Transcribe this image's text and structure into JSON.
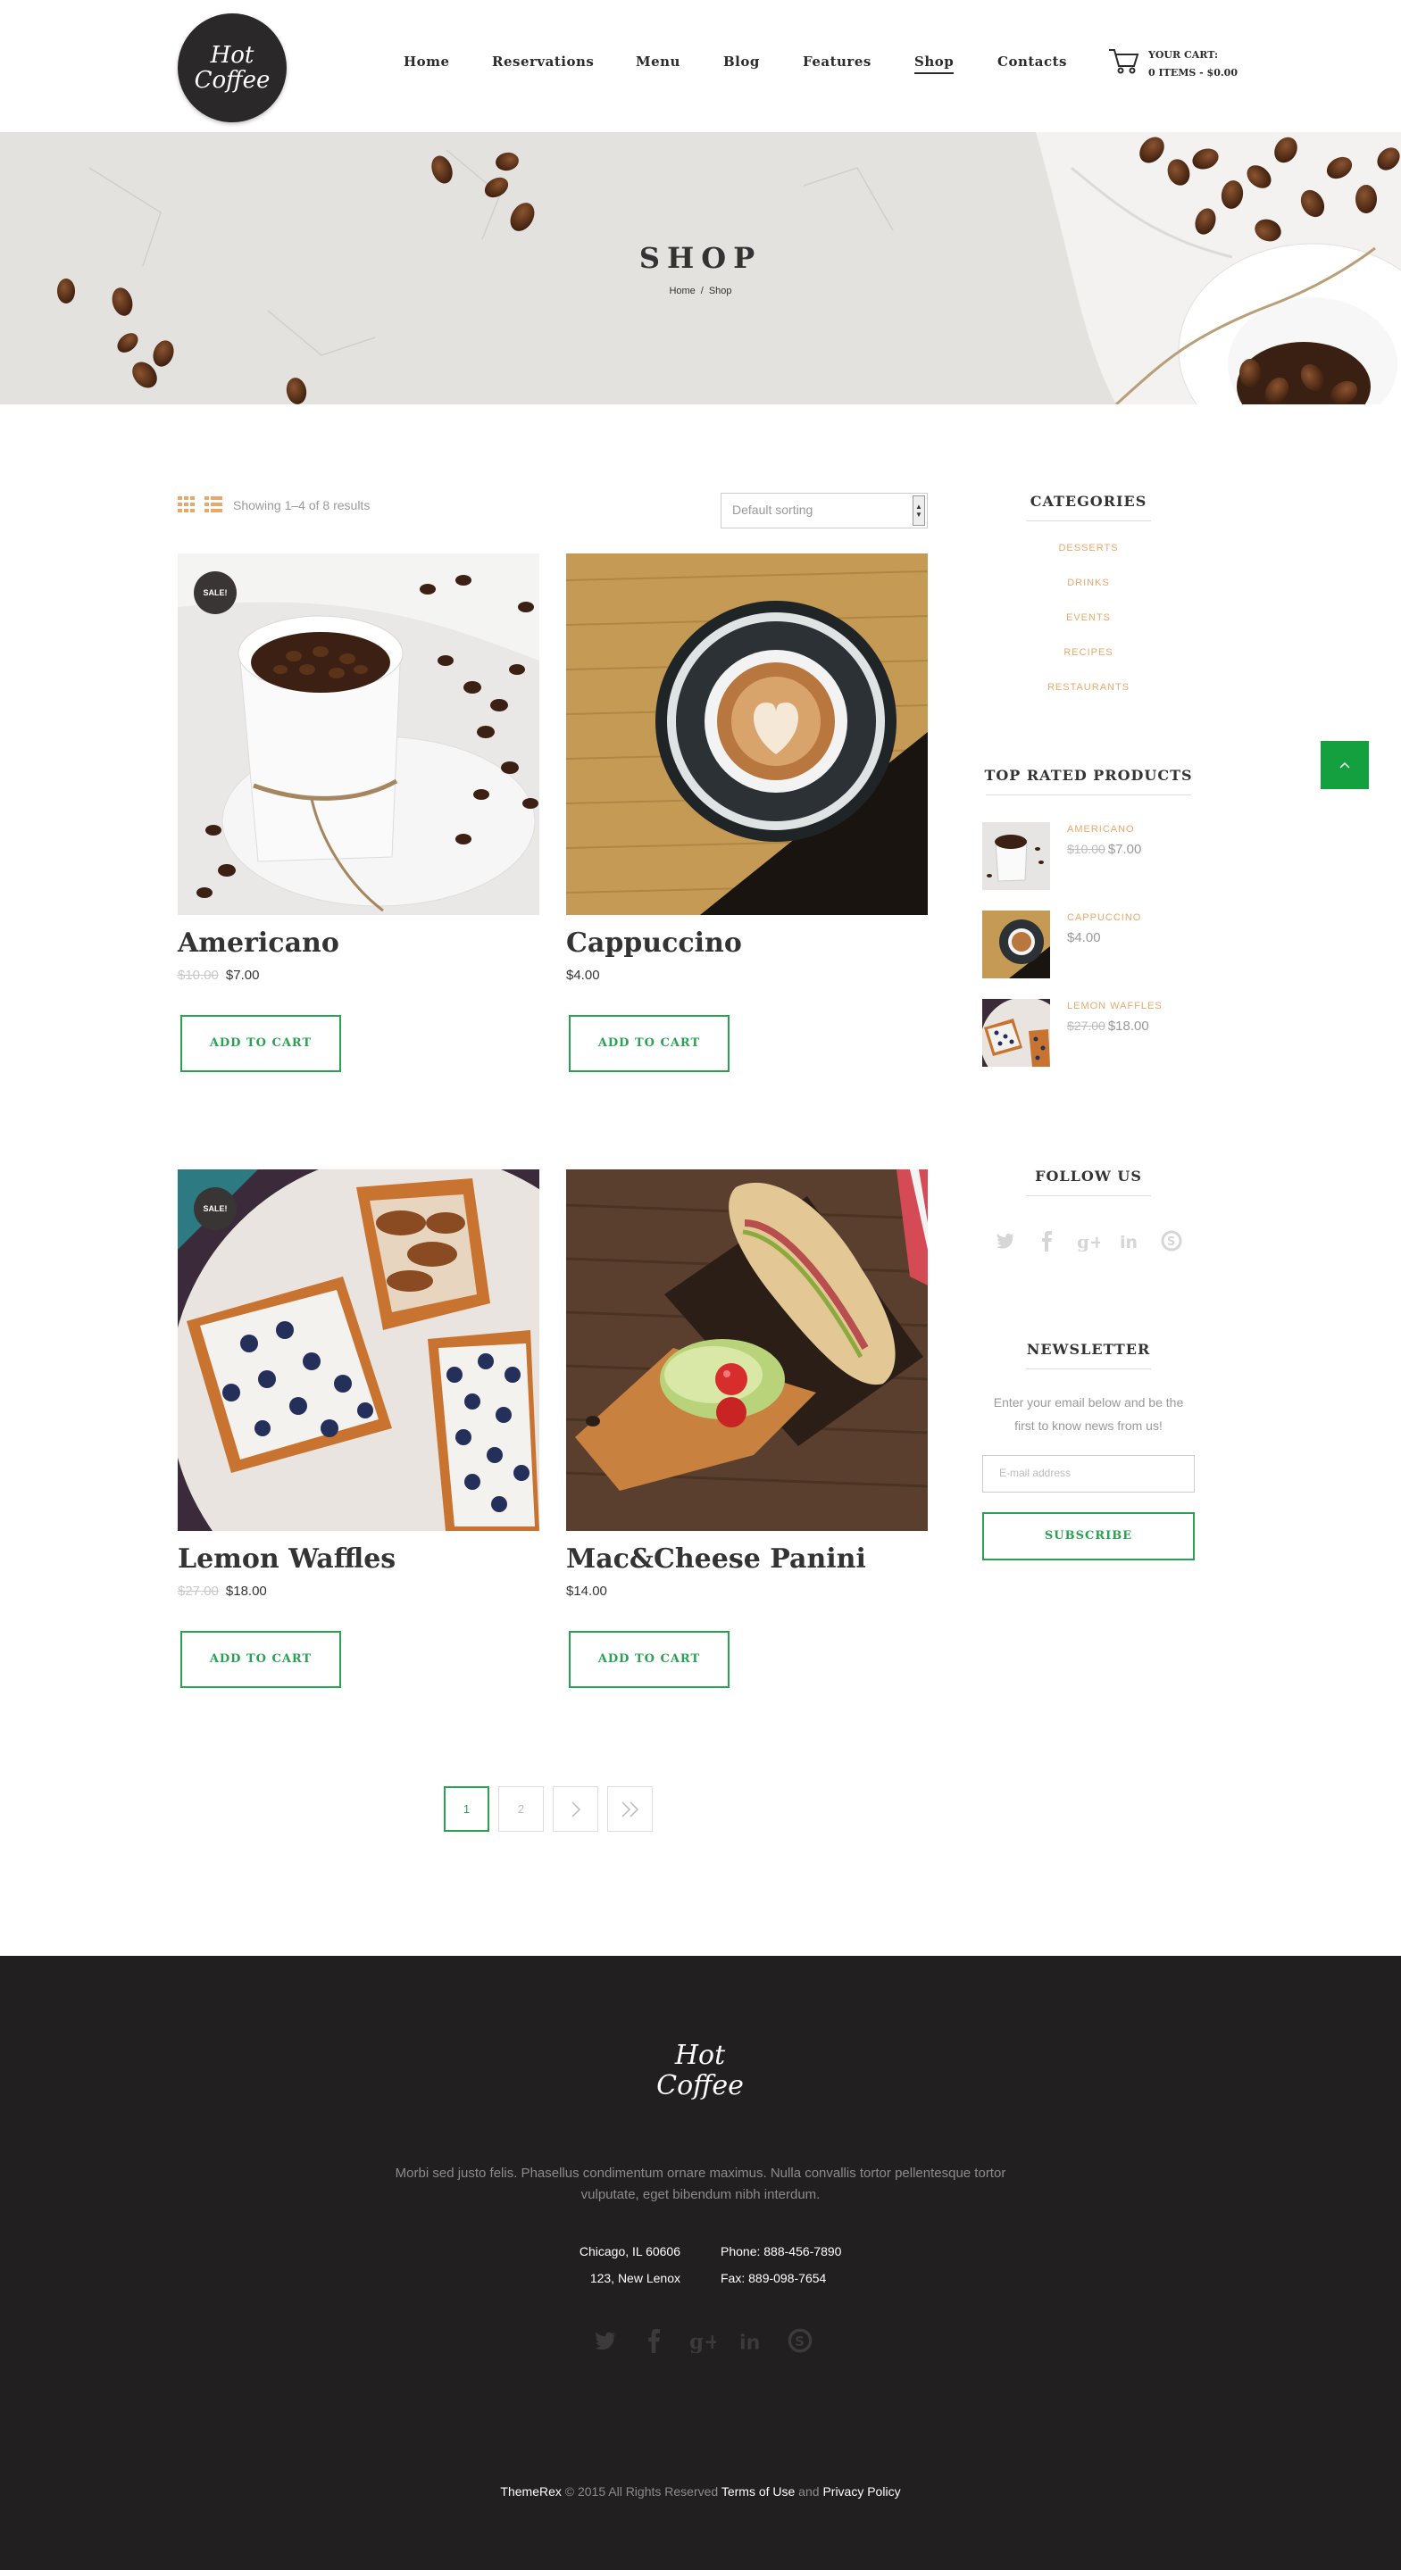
{
  "header": {
    "logo_text": "Hot\nCoffee",
    "nav": [
      "Home",
      "Reservations",
      "Menu",
      "Blog",
      "Features",
      "Shop",
      "Contacts"
    ],
    "active_nav": "Shop",
    "cart_label": "YOUR CART:",
    "cart_summary": "0 ITEMS - $0.00"
  },
  "banner": {
    "title": "SHOP",
    "breadcrumb_home": "Home",
    "breadcrumb_sep": "/",
    "breadcrumb_current": "Shop"
  },
  "toolbar": {
    "results_text": "Showing 1–4 of 8 results",
    "sort_value": "Default sorting"
  },
  "products": [
    {
      "name": "Americano",
      "old_price": "$10.00",
      "price": "$7.00",
      "sale": "SALE!",
      "button": "ADD TO CART"
    },
    {
      "name": "Cappuccino",
      "old_price": "",
      "price": "$4.00",
      "sale": "",
      "button": "ADD TO CART"
    },
    {
      "name": "Lemon Waffles",
      "old_price": "$27.00",
      "price": "$18.00",
      "sale": "SALE!",
      "button": "ADD TO CART"
    },
    {
      "name": "Mac&Cheese Panini",
      "old_price": "",
      "price": "$14.00",
      "sale": "",
      "button": "ADD TO CART"
    }
  ],
  "pagination": {
    "current": "1",
    "next_page": "2",
    "icons": [
      "chevron-right-icon",
      "double-chevron-right-icon"
    ]
  },
  "sidebar": {
    "categories_title": "CATEGORIES",
    "categories": [
      "DESSERTS",
      "DRINKS",
      "EVENTS",
      "RECIPES",
      "RESTAURANTS"
    ],
    "top_rated_title": "TOP RATED PRODUCTS",
    "top_rated": [
      {
        "name": "AMERICANO",
        "old_price": "$10.00",
        "price": "$7.00"
      },
      {
        "name": "CAPPUCCINO",
        "old_price": "",
        "price": "$4.00"
      },
      {
        "name": "LEMON WAFFLES",
        "old_price": "$27.00",
        "price": "$18.00"
      }
    ],
    "follow_title": "FOLLOW US",
    "social_icons": [
      "twitter-icon",
      "facebook-icon",
      "google-plus-icon",
      "linkedin-icon",
      "skype-icon"
    ],
    "newsletter_title": "NEWSLETTER",
    "newsletter_text": "Enter your email below and be the first to know news from us!",
    "email_placeholder": "E-mail address",
    "subscribe_label": "SUBSCRIBE"
  },
  "footer": {
    "logo_text": "Hot\nCoffee",
    "description": "Morbi sed justo felis. Phasellus condimentum ornare maximus. Nulla convallis tortor pellentesque tortor vulputate, eget bibendum nibh interdum.",
    "address_line1": "Chicago, IL 60606",
    "address_line2": "123, New Lenox",
    "phone": "Phone: 888-456-7890",
    "fax": "Fax: 889-098-7654",
    "copy_brand": "ThemeRex",
    "copy_text": " © 2015 All Rights Reserved ",
    "terms": "Terms of Use",
    "and": " and ",
    "privacy": "Privacy Policy"
  },
  "colors": {
    "accent_green": "#29a052",
    "category_orange": "#e8a86a",
    "footer_bg": "#211f1f"
  }
}
